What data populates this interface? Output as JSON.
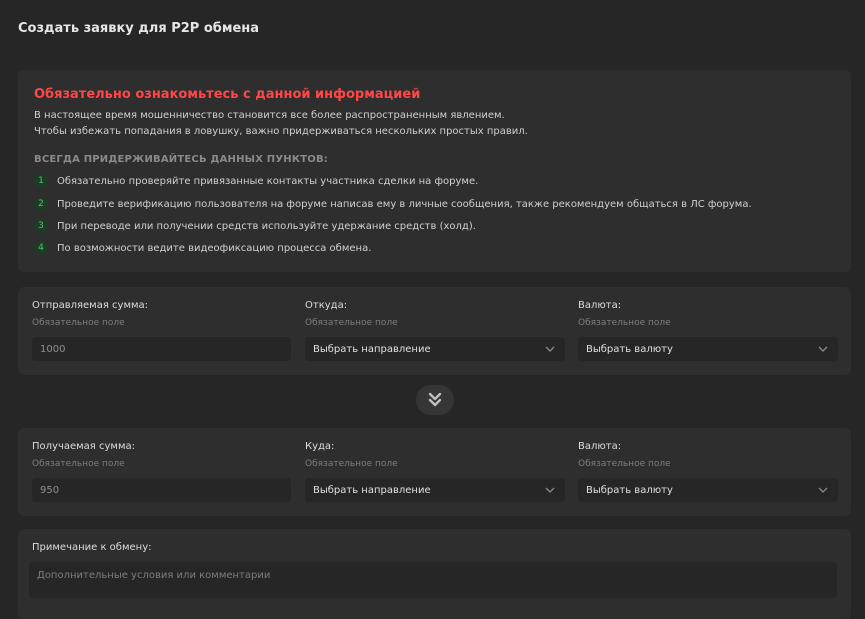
{
  "page": {
    "title": "Создать заявку для P2P обмена"
  },
  "info": {
    "warning_title": "Обязательно ознакомьтесь с данной информацией",
    "lines": [
      "В настоящее время мошенничество становится все более распространенным явлением.",
      "Чтобы избежать попадания в ловушку, важно придерживаться нескольких простых правил."
    ],
    "rules_heading": "ВСЕГДА ПРИДЕРЖИВАЙТЕСЬ ДАННЫХ ПУНКТОВ:",
    "rules": [
      {
        "num": "1",
        "text": "Обязательно проверяйте привязанные контакты участника сделки на форуме."
      },
      {
        "num": "2",
        "text": "Проведите верификацию пользователя на форуме написав ему в личные сообщения, также рекомендуем общаться в ЛС форума."
      },
      {
        "num": "3",
        "text": "При переводе или получении средств используйте удержание средств (холд)."
      },
      {
        "num": "4",
        "text": "По возможности ведите видеофиксацию процесса обмена."
      }
    ]
  },
  "send": {
    "amount_label": "Отправляемая сумма:",
    "amount_hint": "Обязательное поле",
    "amount_value": "1000",
    "from_label": "Откуда:",
    "from_hint": "Обязательное поле",
    "from_value": "Выбрать направление",
    "currency_label": "Валюта:",
    "currency_hint": "Обязательное поле",
    "currency_value": "Выбрать валюту"
  },
  "receive": {
    "amount_label": "Получаемая сумма:",
    "amount_hint": "Обязательное поле",
    "amount_value": "950",
    "to_label": "Куда:",
    "to_hint": "Обязательное поле",
    "to_value": "Выбрать направление",
    "currency_label": "Валюта:",
    "currency_hint": "Обязательное поле",
    "currency_value": "Выбрать валюту"
  },
  "note": {
    "label": "Примечание к обмену:",
    "placeholder": "Дополнительные условия или комментарии"
  },
  "colors": {
    "warning": "#ff4747",
    "rule_accent": "#4ec46a"
  }
}
